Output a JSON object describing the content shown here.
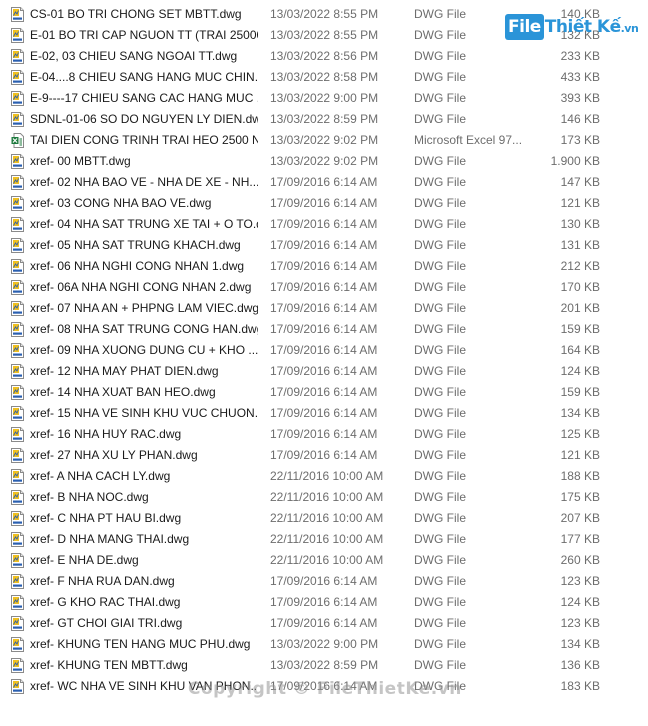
{
  "watermark_text": "Copyright © FileThietKe.vn",
  "logo": {
    "part1": "File",
    "part2": "Thiết Kế",
    "part3": ".vn"
  },
  "colors": {
    "dwg_icon": "#f0c020",
    "excel_icon": "#1d7a3e",
    "meta_text": "#6d6d6d"
  },
  "files": [
    {
      "name": "CS-01  BO TRI CHONG SET MBTT.dwg",
      "date": "13/03/2022 8:55 PM",
      "type": "DWG File",
      "size": "140 KB",
      "icon": "dwg-file-icon"
    },
    {
      "name": "E-01 BO TRI CAP NGUON TT (TRAI 25000)...",
      "date": "13/03/2022 8:55 PM",
      "type": "DWG File",
      "size": "132 KB",
      "icon": "dwg-file-icon"
    },
    {
      "name": "E-02, 03 CHIEU SANG NGOAI TT.dwg",
      "date": "13/03/2022 8:56 PM",
      "type": "DWG File",
      "size": "233 KB",
      "icon": "dwg-file-icon"
    },
    {
      "name": "E-04....8 CHIEU SANG HANG MUC CHIN...",
      "date": "13/03/2022 8:58 PM",
      "type": "DWG File",
      "size": "433 KB",
      "icon": "dwg-file-icon"
    },
    {
      "name": "E-9----17 CHIEU SANG CAC HANG MUC ...",
      "date": "13/03/2022 9:00 PM",
      "type": "DWG File",
      "size": "393 KB",
      "icon": "dwg-file-icon"
    },
    {
      "name": "SDNL-01-06 SO DO NGUYEN LY DIEN.dwg",
      "date": "13/03/2022 8:59 PM",
      "type": "DWG File",
      "size": "146 KB",
      "icon": "dwg-file-icon"
    },
    {
      "name": "TAI DIEN CONG TRINH TRAI HEO 2500 N...",
      "date": "13/03/2022 9:02 PM",
      "type": "Microsoft Excel 97...",
      "size": "173 KB",
      "icon": "excel-file-icon"
    },
    {
      "name": "xref- 00 MBTT.dwg",
      "date": "13/03/2022 9:02 PM",
      "type": "DWG File",
      "size": "1.900 KB",
      "icon": "dwg-file-icon"
    },
    {
      "name": "xref- 02 NHA BAO VE - NHA DE XE - NH...",
      "date": "17/09/2016 6:14 AM",
      "type": "DWG File",
      "size": "147 KB",
      "icon": "dwg-file-icon"
    },
    {
      "name": "xref- 03 CONG NHA BAO VE.dwg",
      "date": "17/09/2016 6:14 AM",
      "type": "DWG File",
      "size": "121 KB",
      "icon": "dwg-file-icon"
    },
    {
      "name": "xref- 04 NHA SAT TRUNG XE TAI + O TO.d...",
      "date": "17/09/2016 6:14 AM",
      "type": "DWG File",
      "size": "130 KB",
      "icon": "dwg-file-icon"
    },
    {
      "name": "xref- 05 NHA SAT TRUNG KHACH.dwg",
      "date": "17/09/2016 6:14 AM",
      "type": "DWG File",
      "size": "131 KB",
      "icon": "dwg-file-icon"
    },
    {
      "name": "xref- 06 NHA NGHI CONG NHAN 1.dwg",
      "date": "17/09/2016 6:14 AM",
      "type": "DWG File",
      "size": "212 KB",
      "icon": "dwg-file-icon"
    },
    {
      "name": "xref- 06A NHA NGHI CONG NHAN 2.dwg",
      "date": "17/09/2016 6:14 AM",
      "type": "DWG File",
      "size": "170 KB",
      "icon": "dwg-file-icon"
    },
    {
      "name": "xref- 07 NHA AN + PHPNG LAM VIEC.dwg",
      "date": "17/09/2016 6:14 AM",
      "type": "DWG File",
      "size": "201 KB",
      "icon": "dwg-file-icon"
    },
    {
      "name": "xref- 08 NHA SAT TRUNG CONG HAN.dwg",
      "date": "17/09/2016 6:14 AM",
      "type": "DWG File",
      "size": "159 KB",
      "icon": "dwg-file-icon"
    },
    {
      "name": "xref- 09 NHA XUONG DUNG CU + KHO ...",
      "date": "17/09/2016 6:14 AM",
      "type": "DWG File",
      "size": "164 KB",
      "icon": "dwg-file-icon"
    },
    {
      "name": "xref- 12 NHA MAY PHAT DIEN.dwg",
      "date": "17/09/2016 6:14 AM",
      "type": "DWG File",
      "size": "124 KB",
      "icon": "dwg-file-icon"
    },
    {
      "name": "xref- 14 NHA XUAT BAN HEO.dwg",
      "date": "17/09/2016 6:14 AM",
      "type": "DWG File",
      "size": "159 KB",
      "icon": "dwg-file-icon"
    },
    {
      "name": "xref- 15 NHA VE SINH KHU VUC CHUON...",
      "date": "17/09/2016 6:14 AM",
      "type": "DWG File",
      "size": "134 KB",
      "icon": "dwg-file-icon"
    },
    {
      "name": "xref- 16 NHA HUY RAC.dwg",
      "date": "17/09/2016 6:14 AM",
      "type": "DWG File",
      "size": "125 KB",
      "icon": "dwg-file-icon"
    },
    {
      "name": "xref- 27 NHA XU LY PHAN.dwg",
      "date": "17/09/2016 6:14 AM",
      "type": "DWG File",
      "size": "121 KB",
      "icon": "dwg-file-icon"
    },
    {
      "name": "xref- A NHA CACH LY.dwg",
      "date": "22/11/2016 10:00 AM",
      "type": "DWG File",
      "size": "188 KB",
      "icon": "dwg-file-icon"
    },
    {
      "name": "xref- B NHA NOC.dwg",
      "date": "22/11/2016 10:00 AM",
      "type": "DWG File",
      "size": "175 KB",
      "icon": "dwg-file-icon"
    },
    {
      "name": "xref- C NHA PT HAU BI.dwg",
      "date": "22/11/2016 10:00 AM",
      "type": "DWG File",
      "size": "207 KB",
      "icon": "dwg-file-icon"
    },
    {
      "name": "xref- D NHA MANG THAI.dwg",
      "date": "22/11/2016 10:00 AM",
      "type": "DWG File",
      "size": "177 KB",
      "icon": "dwg-file-icon"
    },
    {
      "name": "xref- E NHA DE.dwg",
      "date": "22/11/2016 10:00 AM",
      "type": "DWG File",
      "size": "260 KB",
      "icon": "dwg-file-icon"
    },
    {
      "name": "xref- F NHA RUA DAN.dwg",
      "date": "17/09/2016 6:14 AM",
      "type": "DWG File",
      "size": "123 KB",
      "icon": "dwg-file-icon"
    },
    {
      "name": "xref- G KHO RAC THAI.dwg",
      "date": "17/09/2016 6:14 AM",
      "type": "DWG File",
      "size": "124 KB",
      "icon": "dwg-file-icon"
    },
    {
      "name": "xref- GT CHOI GIAI TRI.dwg",
      "date": "17/09/2016 6:14 AM",
      "type": "DWG File",
      "size": "123 KB",
      "icon": "dwg-file-icon"
    },
    {
      "name": "xref- KHUNG TEN HANG MUC PHU.dwg",
      "date": "13/03/2022 9:00 PM",
      "type": "DWG File",
      "size": "134 KB",
      "icon": "dwg-file-icon"
    },
    {
      "name": "xref- KHUNG TEN MBTT.dwg",
      "date": "13/03/2022 8:59 PM",
      "type": "DWG File",
      "size": "136 KB",
      "icon": "dwg-file-icon"
    },
    {
      "name": "xref- WC NHA VE SINH KHU VAN PHON...",
      "date": "17/09/2016 6:14 AM",
      "type": "DWG File",
      "size": "183 KB",
      "icon": "dwg-file-icon"
    }
  ]
}
